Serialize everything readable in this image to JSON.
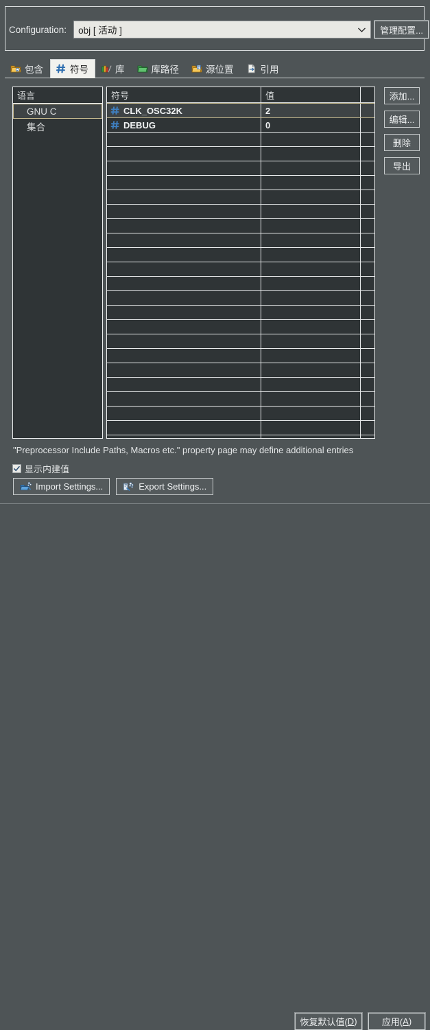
{
  "config": {
    "label": "Configuration:",
    "selected_value": "obj  [ 活动 ]",
    "dropdown_icon": "chevron-down-icon",
    "manage_button": "管理配置..."
  },
  "tabs": [
    {
      "label": "包含",
      "icon": "include-folder-icon",
      "active": false
    },
    {
      "label": "符号",
      "icon": "hash-symbol-icon",
      "active": true
    },
    {
      "label": "库",
      "icon": "library-books-icon",
      "active": false
    },
    {
      "label": "库路径",
      "icon": "library-path-folder-icon",
      "active": false
    },
    {
      "label": "源位置",
      "icon": "source-location-folder-icon",
      "active": false
    },
    {
      "label": "引用",
      "icon": "reference-page-icon",
      "active": false
    }
  ],
  "language_panel": {
    "header": "语言",
    "items": [
      {
        "label": "GNU C",
        "selected": true
      },
      {
        "label": "集合",
        "selected": false
      }
    ]
  },
  "symbol_grid": {
    "columns": [
      "符号",
      "值",
      ""
    ],
    "rows": [
      {
        "icon": "hash-symbol-icon",
        "symbol": "CLK_OSC32K",
        "value": "2",
        "selected": true
      },
      {
        "icon": "hash-symbol-icon",
        "symbol": "DEBUG",
        "value": "0",
        "selected": false
      }
    ],
    "empty_row_count": 22
  },
  "side_buttons": [
    {
      "label": "添加..."
    },
    {
      "label": "编辑..."
    },
    {
      "label": "删除"
    },
    {
      "label": "导出"
    }
  ],
  "note": "\"Preprocessor Include Paths, Macros etc.\" property page may define additional entries",
  "show_builtin": {
    "label": "显示内建值",
    "checked": true,
    "check_icon": "checkmark-icon"
  },
  "io_buttons": [
    {
      "label": "Import Settings...",
      "icon": "import-settings-icon"
    },
    {
      "label": "Export Settings...",
      "icon": "export-settings-icon"
    }
  ],
  "bottom_buttons": {
    "restore_prefix": "恢复默认值(",
    "restore_accel": "D",
    "restore_suffix": ")",
    "apply_prefix": "应用(",
    "apply_accel": "A",
    "apply_suffix": ")"
  },
  "colors": {
    "background": "#4e5456",
    "panel": "#2f3436",
    "border": "#e9ebec",
    "selection_border": "#c3b78e",
    "selection_fill": "#3e4345",
    "combo_background": "#e8e8e4",
    "tab_active_background": "#f2f2ee",
    "symbol_icon_blue": "#3f7fbf"
  }
}
